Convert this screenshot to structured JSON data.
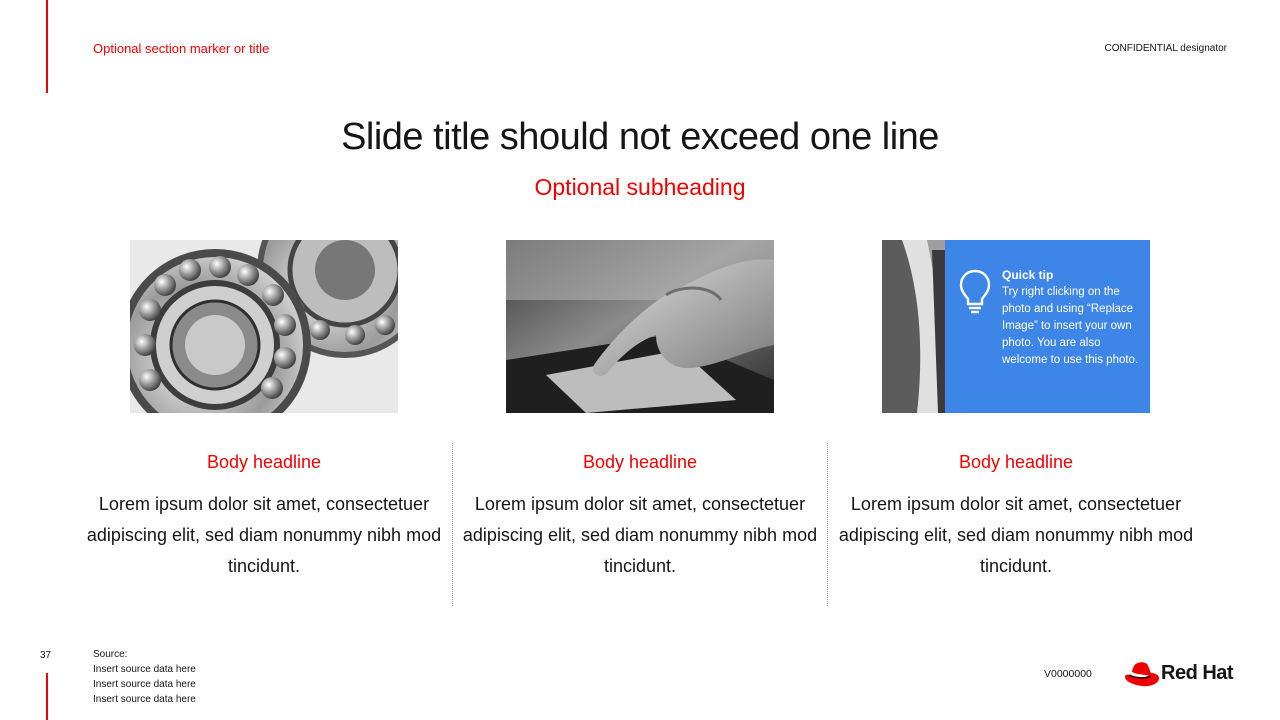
{
  "header": {
    "section_marker": "Optional section marker or title",
    "confidential": "CONFIDENTIAL designator"
  },
  "slide": {
    "title": "Slide title should not exceed one line",
    "subheading": "Optional subheading"
  },
  "columns": [
    {
      "image": "ball-bearings-photo",
      "headline": "Body headline",
      "body": "Lorem ipsum dolor sit amet, consectetuer adipiscing elit, sed diam nonummy nibh mod tincidunt."
    },
    {
      "image": "hand-touching-tablet-photo",
      "headline": "Body headline",
      "body": "Lorem ipsum dolor sit amet, consectetuer adipiscing elit, sed diam nonummy nibh mod tincidunt."
    },
    {
      "image": "curved-structure-photo",
      "headline": "Body headline",
      "body": "Lorem ipsum dolor sit amet, consectetuer adipiscing elit, sed diam nonummy nibh mod tincidunt."
    }
  ],
  "quick_tip": {
    "icon": "lightbulb-icon",
    "title": "Quick tip",
    "text": "Try right clicking on the photo and using “Replace Image” to insert your own photo. You are also welcome to use this photo."
  },
  "footer": {
    "page_number": "37",
    "source_label": "Source:",
    "source_lines": [
      "Insert source data here",
      "Insert source data here",
      "Insert source data here"
    ],
    "version": "V0000000",
    "brand": "Red Hat"
  },
  "colors": {
    "accent_red": "#ee0000",
    "tip_blue": "#3d86e8",
    "text": "#151515"
  }
}
